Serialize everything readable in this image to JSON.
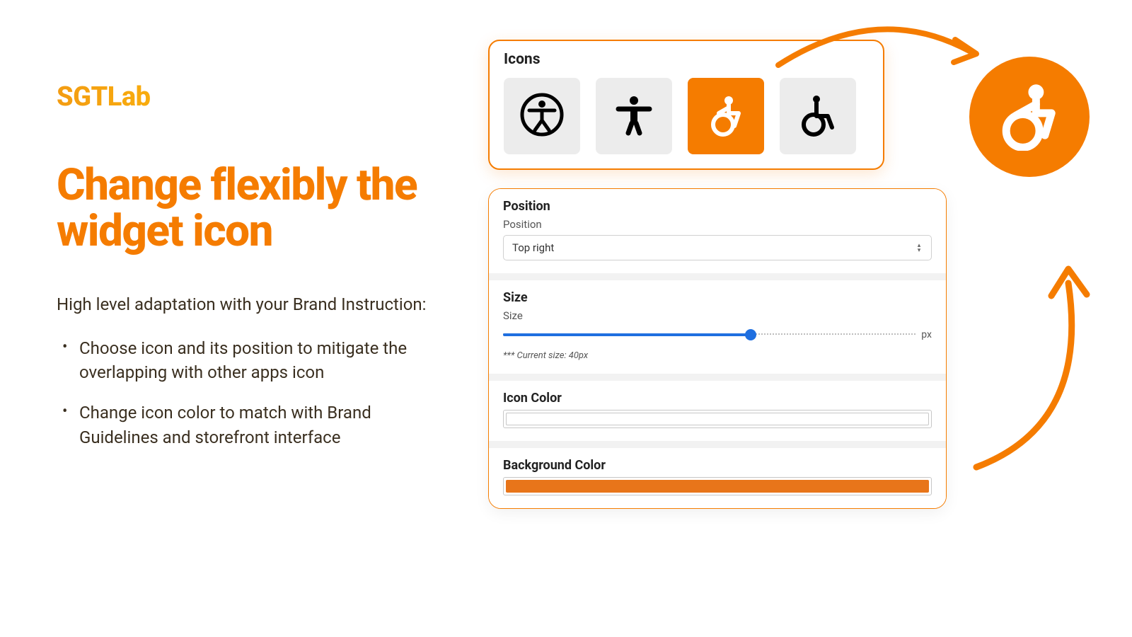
{
  "brand": {
    "logo": "SGTLab"
  },
  "headline": "Change flexibly the widget icon",
  "intro": "High level adaptation with your Brand Instruction:",
  "bullets": [
    "Choose icon and its position to mitigate the overlapping with other apps icon",
    "Change icon color to match with Brand Guidelines and storefront interface"
  ],
  "icons_panel": {
    "title": "Icons"
  },
  "position_panel": {
    "title": "Position",
    "label": "Position",
    "value": "Top right"
  },
  "size_panel": {
    "title": "Size",
    "label": "Size",
    "unit": "px",
    "note": "*** Current size: 40px"
  },
  "icon_color_panel": {
    "title": "Icon Color",
    "value": "#ffffff"
  },
  "bg_color_panel": {
    "title": "Background Color",
    "value": "#e8751a"
  }
}
